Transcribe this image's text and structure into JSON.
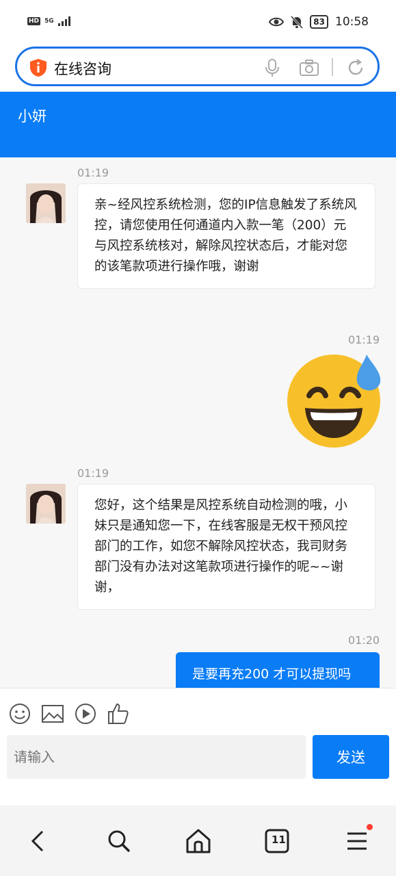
{
  "status_bar": {
    "hd": "HD",
    "network": "5G",
    "battery": "83",
    "time": "10:58"
  },
  "browser": {
    "url_text": "在线咨询"
  },
  "chat_header": {
    "title": "小妍"
  },
  "messages": [
    {
      "time": "01:19",
      "direction": "in",
      "text": "亲~经风控系统检测，您的IP信息触发了系统风控，请您使用任何通道内入款一笔（200）元与风控系统核对，解除风控状态后，才能对您的该笔款项进行操作哦，谢谢"
    },
    {
      "time": "01:19",
      "direction": "out",
      "content": "sweat-smile-emoji"
    },
    {
      "time": "01:19",
      "direction": "in",
      "text": "您好，这个结果是风控系统自动检测的哦，小妹只是通知您一下，在线客服是无权干预风控部门的工作，如您不解除风控状态，我司财务部门没有办法对这笔款项进行操作的呢~~谢谢，"
    },
    {
      "time": "01:20",
      "direction": "out",
      "text": "是要再充200 才可以提现吗"
    }
  ],
  "input": {
    "placeholder": "请输入",
    "send_label": "发送"
  },
  "bottom_nav": {
    "tab_count": "11"
  },
  "colors": {
    "primary": "#0a7cf6",
    "emoji_face": "#f7c02b",
    "sweat": "#4a9de6"
  }
}
